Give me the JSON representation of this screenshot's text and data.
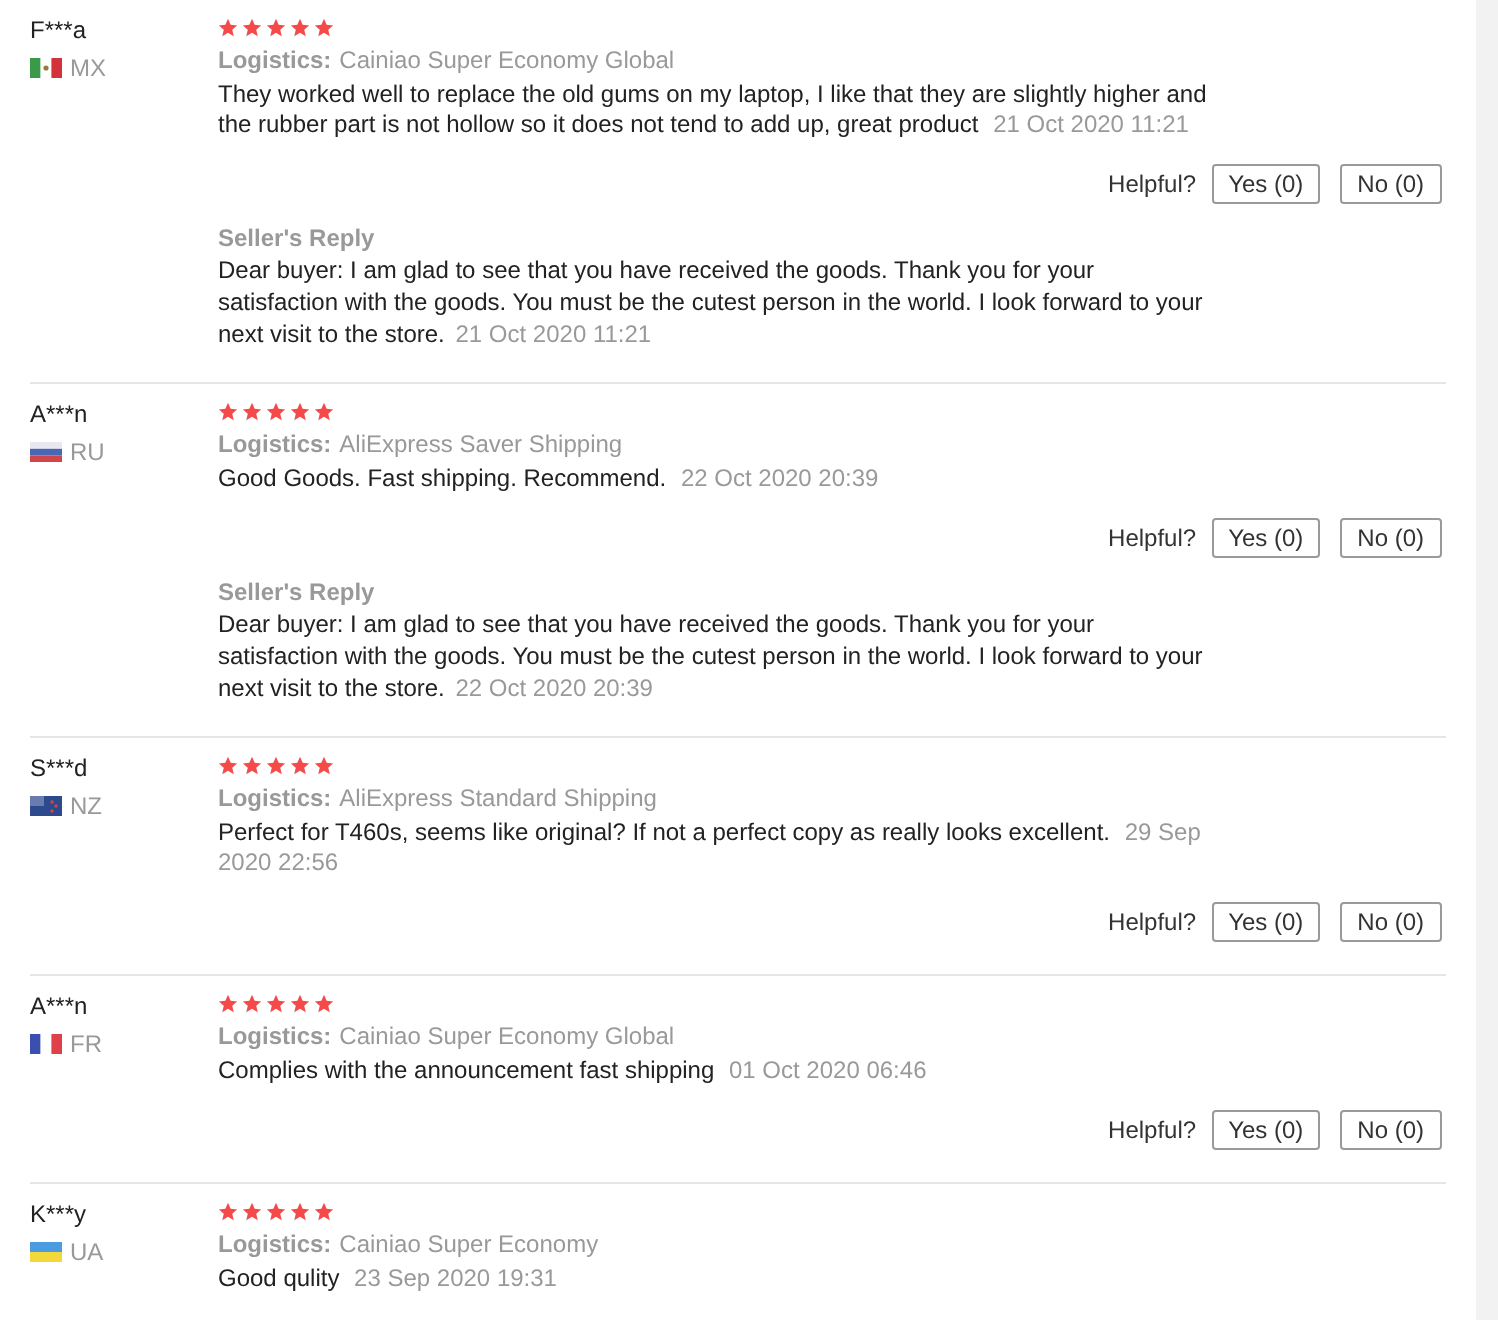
{
  "reviews": [
    {
      "user": "F***a",
      "kind": "mx",
      "country": "MX",
      "stars": 5,
      "logistics_label": "Logistics:",
      "logistics": "Cainiao Super Economy Global",
      "text": "They worked well to replace the old gums on my laptop, I like that they are slightly higher and the rubber part is not hollow so it does not tend to add up, great product",
      "date": "21 Oct 2020 11:21",
      "helpful_label": "Helpful?",
      "yes": "Yes (0)",
      "no": "No (0)",
      "seller_reply": {
        "title": "Seller's Reply",
        "text": "Dear buyer: I am glad to see that you have received the goods. Thank you for your satisfaction with the goods. You must be the cutest person in the world. I look forward to your next visit to the store.",
        "date": "21 Oct 2020 11:21"
      }
    },
    {
      "user": "A***n",
      "kind": "ru",
      "country": "RU",
      "stars": 5,
      "logistics_label": "Logistics:",
      "logistics": "AliExpress Saver Shipping",
      "text": "Good Goods. Fast shipping. Recommend.",
      "date": "22 Oct 2020 20:39",
      "helpful_label": "Helpful?",
      "yes": "Yes (0)",
      "no": "No (0)",
      "seller_reply": {
        "title": "Seller's Reply",
        "text": "Dear buyer: I am glad to see that you have received the goods. Thank you for your satisfaction with the goods. You must be the cutest person in the world. I look forward to your next visit to the store.",
        "date": "22 Oct 2020 20:39"
      }
    },
    {
      "user": "S***d",
      "kind": "nz",
      "country": "NZ",
      "stars": 5,
      "logistics_label": "Logistics:",
      "logistics": "AliExpress Standard Shipping",
      "text": "Perfect for T460s, seems like original? If not a perfect copy as really looks excellent.",
      "date": "29 Sep 2020 22:56",
      "helpful_label": "Helpful?",
      "yes": "Yes (0)",
      "no": "No (0)"
    },
    {
      "user": "A***n",
      "kind": "fr",
      "country": "FR",
      "stars": 5,
      "logistics_label": "Logistics:",
      "logistics": "Cainiao Super Economy Global",
      "text": "Complies with the announcement fast shipping",
      "date": "01 Oct 2020 06:46",
      "helpful_label": "Helpful?",
      "yes": "Yes (0)",
      "no": "No (0)"
    },
    {
      "user": "K***y",
      "kind": "ua",
      "country": "UA",
      "stars": 5,
      "logistics_label": "Logistics:",
      "logistics": "Cainiao Super Economy",
      "text": "Good qulity",
      "date": "23 Sep 2020 19:31"
    }
  ]
}
